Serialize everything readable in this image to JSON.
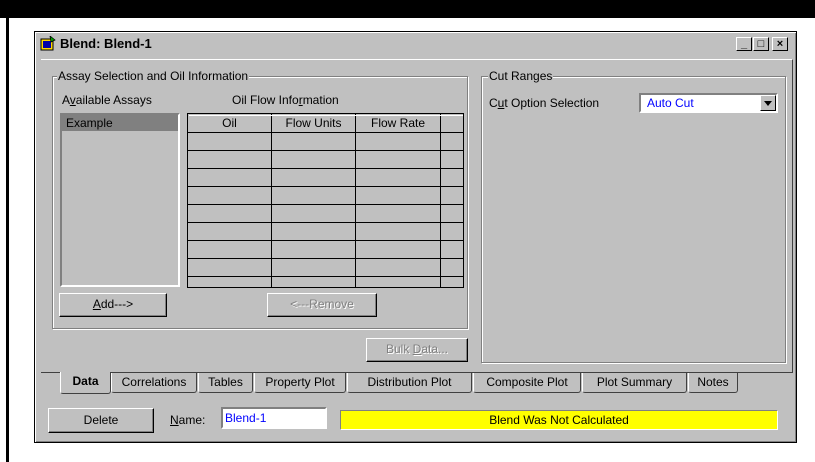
{
  "window": {
    "title": "Blend: Blend-1",
    "minimize_glyph": "_",
    "maximize_glyph": "□",
    "close_glyph": "×"
  },
  "assay_group": {
    "title": "Assay Selection and Oil Information",
    "available_label_pre": "A",
    "available_label_ul": "v",
    "available_label_post": "ailable Assays",
    "oil_flow_label_pre": "Oil Flow Info",
    "oil_flow_label_ul": "r",
    "oil_flow_label_post": "mation",
    "assays": [
      "Example"
    ],
    "grid_columns": [
      "Oil",
      "Flow Units",
      "Flow Rate"
    ],
    "add_button_ul": "A",
    "add_button_post": "dd--->",
    "remove_button": "<---Remove"
  },
  "bulk_data_button_pre": "Bulk ",
  "bulk_data_button_ul": "D",
  "bulk_data_button_post": "ata...",
  "cut_ranges": {
    "title": "Cut Ranges",
    "option_label_pre": "C",
    "option_label_ul": "u",
    "option_label_post": "t Option Selection",
    "option_value": "Auto Cut"
  },
  "tabs": [
    "Data",
    "Correlations",
    "Tables",
    "Property Plot",
    "Distribution Plot",
    "Composite Plot",
    "Plot Summary",
    "Notes"
  ],
  "footer": {
    "delete_button": "Delete",
    "name_label_ul": "N",
    "name_label_post": "ame:",
    "name_value": "Blend-1",
    "status_text": "Blend Was Not Calculated",
    "status_color": "#ffff00"
  },
  "colors": {
    "face": "#c0c0c0",
    "selection": "#808080",
    "value_text": "#0000ff"
  }
}
